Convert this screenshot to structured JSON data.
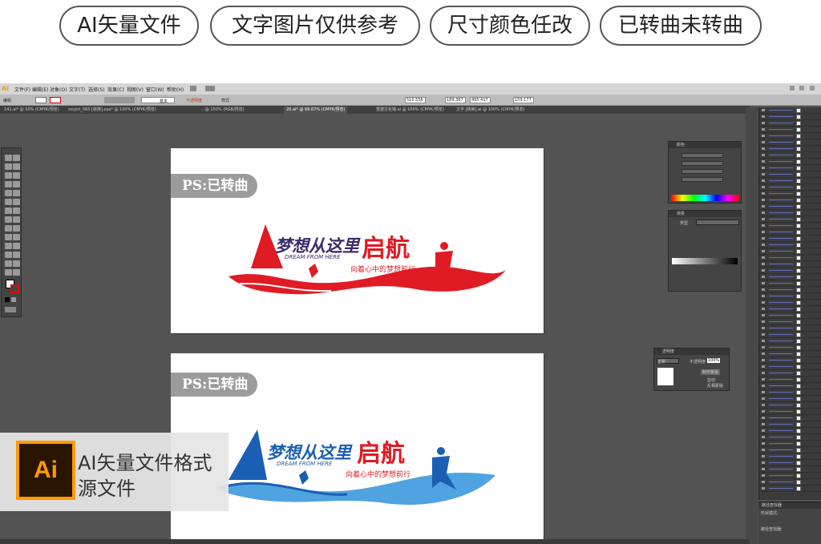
{
  "tags": [
    "AI矢量文件",
    "文字图片仅供参考",
    "尺寸颜色任改",
    "已转曲未转曲"
  ],
  "menu": {
    "logo": "Ai",
    "items": [
      "文件(F)",
      "编辑(E)",
      "对象(O)",
      "文字(T)",
      "选择(S)",
      "效果(C)",
      "视图(V)",
      "窗口(W)",
      "帮助(H)"
    ]
  },
  "control_bar": {
    "group_label": "编组",
    "stroke_label": "基本",
    "opacity_label": "不透明度",
    "style_label": "样式",
    "x": "510.556",
    "y": "189.367",
    "w": "495.417",
    "h": "159.177"
  },
  "doc_tabs": [
    "141.ai* @ 50% (CMYK/预览)",
    "xxyjnt_065 [转换].eps* @ 100% (CMYK/预览)",
    "...@ 150% (RGB/预览)",
    "20.ai* @ 66.67% (CMYK/预览)",
    "党建文化墙.ai @ 100% (CMYK/预览)",
    "文字 [转换].ai @ 100% (CMYK/预览)"
  ],
  "artboards": [
    {
      "ps_label": "PS:已转曲",
      "title_main": "梦想从这里",
      "title_accent": "启航",
      "subtitle_en": "DREAM FROM HERE",
      "slogan": "向着心中的梦想前行"
    },
    {
      "ps_label": "PS:已转曲",
      "title_main": "梦想从这里",
      "title_accent": "启航",
      "subtitle_en": "DREAM FROM HERE",
      "slogan": "向着心中的梦想前行"
    }
  ],
  "panels": {
    "color_title": "颜色",
    "gradient_title": "渐变",
    "gradient_type": "类型",
    "transparency_title": "透明度",
    "blend_mode": "正常",
    "opacity_label": "不透明度",
    "opacity_value": "100%",
    "make_mask": "制作蒙版",
    "clip": "剪切",
    "invert_mask": "反相蒙版",
    "pathfinder_title": "路径查找器",
    "shape_modes": "形状模式:",
    "pathfinders": "路径查找器:"
  },
  "badge": {
    "logo": "Ai",
    "line1": "AI矢量文件格式",
    "line2": "源文件"
  },
  "colors": {
    "ai_orange": "#ff9a00",
    "red": "#e01b24",
    "blue": "#1a5fb4",
    "light_blue": "#4fa3e0"
  }
}
